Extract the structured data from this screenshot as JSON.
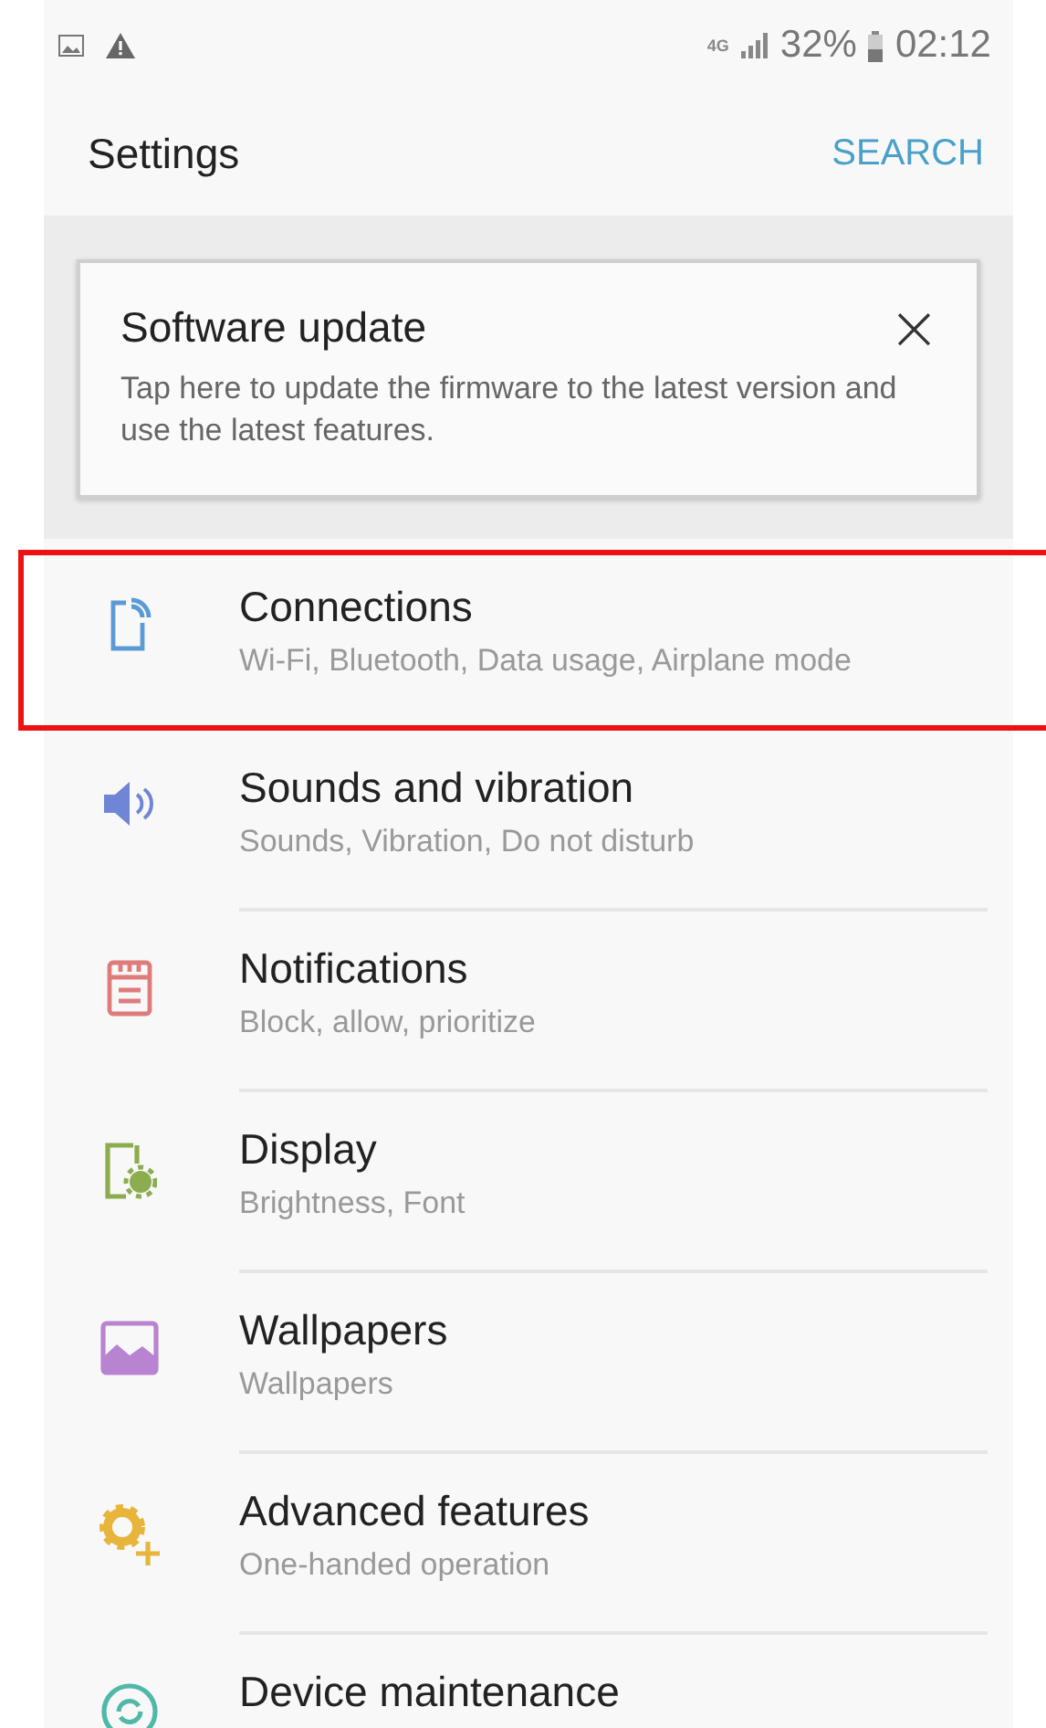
{
  "status_bar": {
    "network": "4G",
    "battery": "32%",
    "time": "02:12"
  },
  "header": {
    "title": "Settings",
    "action": "SEARCH"
  },
  "update_card": {
    "title": "Software update",
    "body": "Tap here to update the firmware to the latest version and use the latest features.",
    "close": "×"
  },
  "items": [
    {
      "title": "Connections",
      "subtitle": "Wi-Fi, Bluetooth, Data usage, Airplane mode",
      "color": "#5b9bd5",
      "highlighted": true
    },
    {
      "title": "Sounds and vibration",
      "subtitle": "Sounds, Vibration, Do not disturb",
      "color": "#6f86d6",
      "highlighted": false
    },
    {
      "title": "Notifications",
      "subtitle": "Block, allow, prioritize",
      "color": "#e07b7b",
      "highlighted": false
    },
    {
      "title": "Display",
      "subtitle": "Brightness, Font",
      "color": "#8bad4f",
      "highlighted": false
    },
    {
      "title": "Wallpapers",
      "subtitle": "Wallpapers",
      "color": "#b883d0",
      "highlighted": false
    },
    {
      "title": "Advanced features",
      "subtitle": "One-handed operation",
      "color": "#e8b53c",
      "highlighted": false
    },
    {
      "title": "Device maintenance",
      "color": "#4fb8a8",
      "highlighted": false
    }
  ]
}
